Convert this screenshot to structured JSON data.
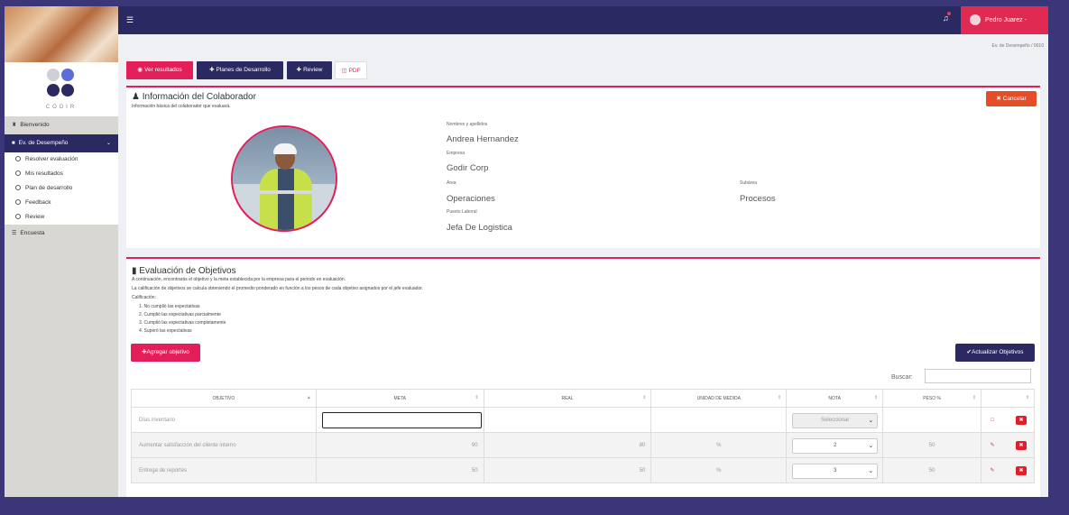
{
  "sidebar": {
    "logo_text": "CODIR",
    "items": [
      {
        "label": "Bienvenido",
        "icon": "home-icon"
      },
      {
        "label": "Ev. de Desempeño",
        "icon": "chart-icon"
      },
      {
        "label": "Encuesta",
        "icon": "list-icon"
      }
    ],
    "subitems": [
      "Resolver evaluación",
      "Mis resultados",
      "Plan de desarrollo",
      "Feedback",
      "Review"
    ]
  },
  "topbar": {
    "user_name": "Pedro Juarez -"
  },
  "breadcrumb": "Ev. de Desempeño  /  0010",
  "tabs": {
    "results": "Ver resultados",
    "plans": "Planes de Desarrollo",
    "review": "Review",
    "pdf": "PDF"
  },
  "collaborator": {
    "title": "Información del Colaborador",
    "subtitle": "Información básica del colaborador que evaluará.",
    "cancel_label": "Cancelar",
    "name_label": "Nombres y apellidos",
    "name": "Andrea Hernandez",
    "company_label": "Empresa",
    "company": "Godir Corp",
    "area_label": "Área",
    "area": "Operaciones",
    "subarea_label": "Subárea",
    "subarea": "Procesos",
    "position_label": "Puesto Laboral",
    "position": "Jefa De Logistica"
  },
  "evaluation": {
    "title": "Evaluación de Objetivos",
    "line1": "A continuación, encontrarás el objetivo y la meta establecida por la empresa para el periodo en evaluación.",
    "line2": "La calificación de objetivos se calcula obteniendo el promedio ponderado en función a los pesos de cada objetivo asignados por el jefe evaluador.",
    "line3": "Calificación:",
    "scale": [
      "1. No cumplió las expectativas",
      "2. Cumplió las expectativas parcialmente",
      "3. Cumplió las expectativas completamente",
      "4. Superó las expectativas"
    ],
    "add_label": "Agregar objetivo",
    "update_label": "Actualizar Objetivos",
    "search_label": "Buscar:",
    "columns": [
      "OBJETIVO",
      "META",
      "REAL",
      "UNIDAD DE MEDIDA",
      "NOTA",
      "PESO %",
      ""
    ],
    "rows": [
      {
        "objetivo": "Días inventario",
        "meta": "",
        "real": "",
        "unidad": "",
        "nota": "Seleccionar",
        "peso": ""
      },
      {
        "objetivo": "Aumentar satisfacción del cliente interno",
        "meta": "90",
        "real": "80",
        "unidad": "%",
        "nota": "2",
        "peso": "50"
      },
      {
        "objetivo": "Entrega de reportes",
        "meta": "50",
        "real": "50",
        "unidad": "%",
        "nota": "3",
        "peso": "50"
      }
    ]
  },
  "colors": {
    "navy": "#2b2962",
    "pink": "#e31e58",
    "orange": "#e44d26"
  }
}
